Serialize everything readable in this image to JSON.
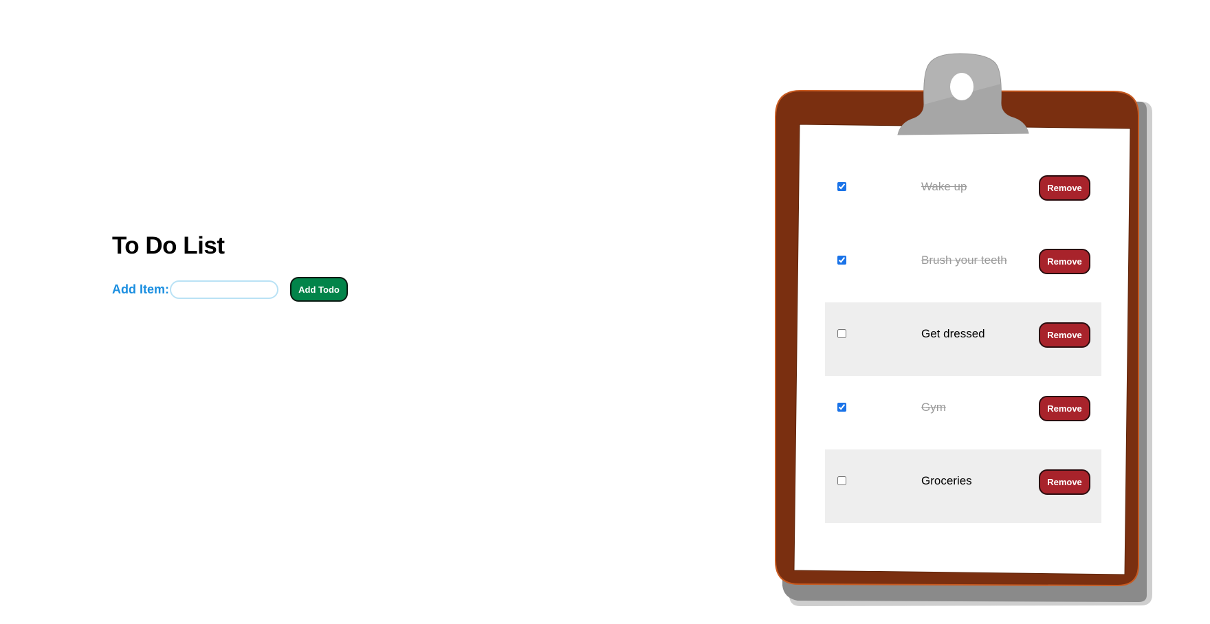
{
  "app": {
    "heading": "To Do List",
    "add_label": "Add Item:",
    "add_input_value": "",
    "add_input_placeholder": "",
    "add_button_label": "Add Todo"
  },
  "todos": [
    {
      "text": "Wake up",
      "done": true,
      "remove_label": "Remove"
    },
    {
      "text": "Brush your teeth",
      "done": true,
      "remove_label": "Remove"
    },
    {
      "text": "Get dressed",
      "done": false,
      "remove_label": "Remove"
    },
    {
      "text": "Gym",
      "done": true,
      "remove_label": "Remove"
    },
    {
      "text": "Groceries",
      "done": false,
      "remove_label": "Remove"
    }
  ],
  "colors": {
    "label_blue": "#1a8ee0",
    "add_button_green": "#02844a",
    "remove_button_red": "#a8232b",
    "clipboard_brown": "#7a2f10",
    "clip_gray": "#b3b3b3"
  }
}
